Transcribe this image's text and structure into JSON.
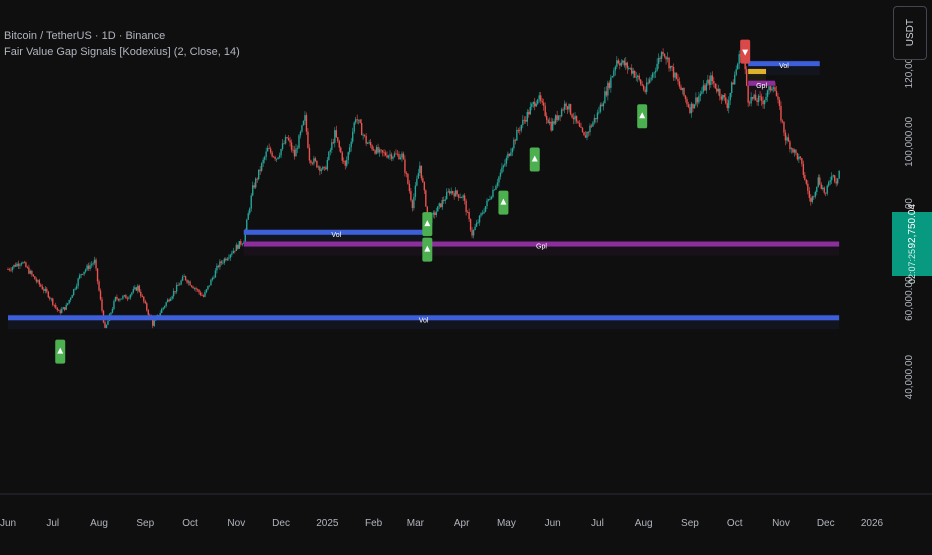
{
  "header": {
    "symbol_title": "Bitcoin / TetherUS · 1D · Binance",
    "indicator_title": "Fair Value Gap Signals [Kodexius] (2, Close, 14)",
    "currency": "USDT"
  },
  "last_price": {
    "value": "92,750.04",
    "countdown": "02:07:25"
  },
  "colors": {
    "background": "#0f0f0f",
    "up_candle": "#26a69a",
    "down_candle": "#ef5350",
    "bull_signal": "#4caf50",
    "bear_signal": "#d94949",
    "fvg_blue": "#3d5fd9",
    "fvg_purple": "#8c2f9c",
    "fvg_yellow": "#e0b22c",
    "price_tag": "#089981"
  },
  "chart_data": {
    "type": "candlestick",
    "y_axis_labels": [
      "120,000.00",
      "100,000.00",
      "80,000.00",
      "60,000.00",
      "40,000.00"
    ],
    "x_axis_labels": [
      "Jun",
      "Jul",
      "Aug",
      "Sep",
      "Oct",
      "Nov",
      "Dec",
      "2025",
      "Feb",
      "Mar",
      "Apr",
      "May",
      "Jun",
      "Jul",
      "Aug",
      "Sep",
      "Oct",
      "Nov",
      "Dec",
      "2026"
    ],
    "x_range": [
      "2024-06-01",
      "2026-01-01"
    ],
    "ylim": [
      35000,
      132000
    ],
    "last_price": 92750.04,
    "price_path": [
      [
        "2024-06-01",
        67500
      ],
      [
        "2024-06-10",
        69500
      ],
      [
        "2024-06-20",
        64500
      ],
      [
        "2024-06-28",
        61000
      ],
      [
        "2024-07-05",
        56500
      ],
      [
        "2024-07-10",
        58000
      ],
      [
        "2024-07-20",
        66500
      ],
      [
        "2024-07-29",
        69500
      ],
      [
        "2024-08-05",
        52000
      ],
      [
        "2024-08-12",
        60000
      ],
      [
        "2024-08-20",
        60500
      ],
      [
        "2024-08-27",
        63000
      ],
      [
        "2024-09-06",
        53500
      ],
      [
        "2024-09-15",
        59000
      ],
      [
        "2024-09-27",
        65500
      ],
      [
        "2024-10-10",
        60500
      ],
      [
        "2024-10-20",
        68500
      ],
      [
        "2024-10-29",
        72000
      ],
      [
        "2024-11-06",
        75000
      ],
      [
        "2024-11-12",
        88000
      ],
      [
        "2024-11-22",
        98000
      ],
      [
        "2024-11-28",
        96000
      ],
      [
        "2024-12-05",
        101000
      ],
      [
        "2024-12-10",
        96500
      ],
      [
        "2024-12-17",
        106000
      ],
      [
        "2024-12-20",
        96000
      ],
      [
        "2024-12-30",
        92500
      ],
      [
        "2025-01-06",
        102000
      ],
      [
        "2025-01-13",
        93500
      ],
      [
        "2025-01-20",
        106500
      ],
      [
        "2025-01-27",
        100000
      ],
      [
        "2025-02-05",
        97000
      ],
      [
        "2025-02-20",
        96500
      ],
      [
        "2025-02-27",
        84000
      ],
      [
        "2025-03-04",
        94000
      ],
      [
        "2025-03-10",
        79500
      ],
      [
        "2025-03-24",
        87500
      ],
      [
        "2025-04-02",
        86000
      ],
      [
        "2025-04-08",
        76500
      ],
      [
        "2025-04-20",
        86000
      ],
      [
        "2025-04-30",
        94500
      ],
      [
        "2025-05-09",
        103000
      ],
      [
        "2025-05-22",
        111500
      ],
      [
        "2025-05-31",
        104000
      ],
      [
        "2025-06-10",
        110000
      ],
      [
        "2025-06-22",
        101000
      ],
      [
        "2025-07-01",
        107000
      ],
      [
        "2025-07-10",
        116000
      ],
      [
        "2025-07-14",
        121000
      ],
      [
        "2025-07-25",
        118000
      ],
      [
        "2025-08-02",
        113000
      ],
      [
        "2025-08-14",
        123500
      ],
      [
        "2025-08-22",
        116500
      ],
      [
        "2025-09-01",
        108500
      ],
      [
        "2025-09-15",
        116000
      ],
      [
        "2025-09-26",
        109500
      ],
      [
        "2025-10-06",
        124500
      ],
      [
        "2025-10-10",
        111000
      ],
      [
        "2025-10-20",
        110500
      ],
      [
        "2025-10-27",
        115000
      ],
      [
        "2025-11-04",
        101000
      ],
      [
        "2025-11-14",
        95000
      ],
      [
        "2025-11-21",
        84500
      ],
      [
        "2025-11-26",
        90500
      ],
      [
        "2025-12-01",
        86500
      ],
      [
        "2025-12-05",
        92000
      ],
      [
        "2025-12-08",
        90000
      ],
      [
        "2025-12-10",
        92750
      ]
    ],
    "fvg_zones": [
      {
        "label": "Vol",
        "color": "#3d5fd9",
        "price": 55000,
        "start": "2024-06-01",
        "end": "2025-12-10"
      },
      {
        "label": "Vol",
        "color": "#3d5fd9",
        "price": 76800,
        "start": "2024-11-06",
        "end": "2025-03-10"
      },
      {
        "label": "Gpl",
        "color": "#8c2f9c",
        "price": 73800,
        "start": "2024-11-06",
        "end": "2025-12-10"
      },
      {
        "label": "Vol",
        "color": "#3d5fd9",
        "price": 119800,
        "start": "2025-10-10",
        "end": "2025-11-27"
      },
      {
        "label": "",
        "color": "#e0b22c",
        "price": 117800,
        "start": "2025-10-10",
        "end": "2025-10-22"
      },
      {
        "label": "Gpl",
        "color": "#8c2f9c",
        "price": 114800,
        "start": "2025-10-10",
        "end": "2025-10-28"
      }
    ],
    "signals": [
      {
        "type": "bull",
        "date": "2024-07-06",
        "price": 46500
      },
      {
        "type": "bull",
        "date": "2025-03-09",
        "price": 79000
      },
      {
        "type": "bull",
        "date": "2025-03-09",
        "price": 72500
      },
      {
        "type": "bull",
        "date": "2025-04-29",
        "price": 84500
      },
      {
        "type": "bull",
        "date": "2025-05-20",
        "price": 95500
      },
      {
        "type": "bull",
        "date": "2025-07-31",
        "price": 106500
      },
      {
        "type": "bear",
        "date": "2025-10-08",
        "price": 123000
      }
    ]
  }
}
